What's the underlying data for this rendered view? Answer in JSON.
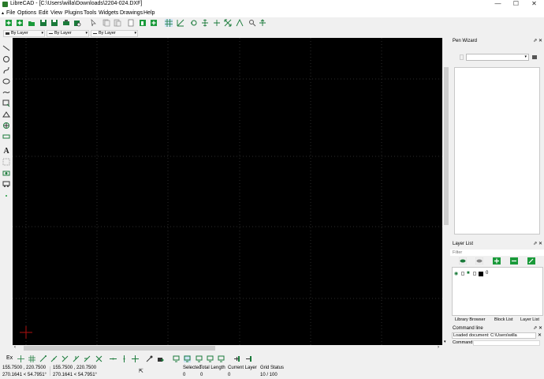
{
  "window": {
    "title": "LibreCAD - [C:\\Users\\willa\\Downloads\\2204-024.DXF]",
    "controls": [
      "—",
      "☐",
      "✕"
    ]
  },
  "menubar": {
    "items": [
      "File",
      "Options",
      "Edit",
      "View",
      "Plugins",
      "Tools",
      "Widgets",
      "Drawings",
      "Help"
    ]
  },
  "pen_toolbar": {
    "color": "By Layer",
    "width": "By Layer",
    "linetype": "By Layer"
  },
  "docks": {
    "pen_wizard": {
      "title": "Pen Wizard"
    },
    "layer_list": {
      "title": "Layer List",
      "filter_placeholder": "Filter",
      "layers": [
        {
          "name": "0",
          "color": "#000000"
        }
      ]
    },
    "tabs": [
      "Library Browser",
      "Block List",
      "Layer List"
    ],
    "command_line": {
      "title": "Command line",
      "output": "Loaded document: C:\\Users\\willa",
      "prompt": "Command:"
    }
  },
  "snap_toolbar": {
    "ex_label": "Ex"
  },
  "status": {
    "abs_coord": "155.7500 , 220.7500",
    "abs_polar": "270.1641 < 54.7951°",
    "rel_coord": "155.7500 , 220.7500",
    "rel_polar": "270.1641 < 54.7951°",
    "selected_label": "Selected",
    "selected_value": "0",
    "total_length_label": "Total Length",
    "total_length_value": "0",
    "current_layer_label": "Current Layer",
    "current_layer_value": "0",
    "grid_status_label": "Grid Status",
    "grid_status_value": "10 / 100"
  },
  "colors": {
    "canvas_bg": "#000000",
    "grid_line": "#3a3a3a",
    "origin_marker": "#b01010",
    "accent": "#1a8a3a"
  }
}
